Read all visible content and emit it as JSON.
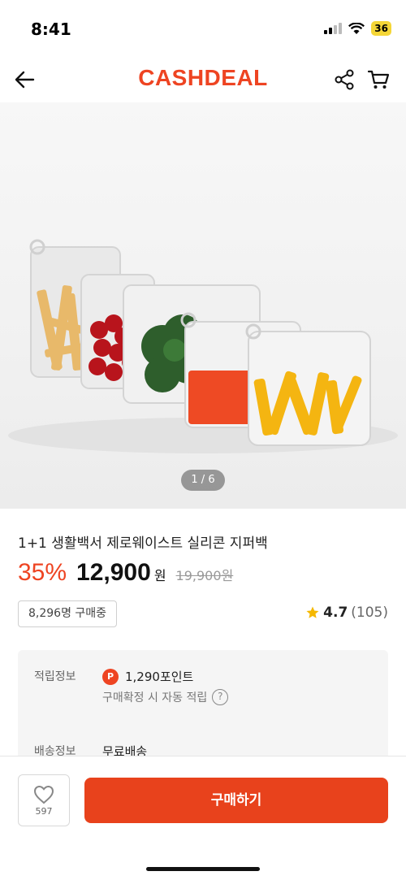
{
  "status_bar": {
    "time": "8:41",
    "battery": "36"
  },
  "header": {
    "logo": "CASHDEAL"
  },
  "gallery": {
    "counter": "1 / 6"
  },
  "product": {
    "title": "1+1 생활백서 제로웨이스트 실리콘 지퍼백",
    "discount": "35%",
    "price": "12,900",
    "currency": "원",
    "original_price": "19,900원",
    "buyers": "8,296명 구매중",
    "rating": "4.7",
    "review_count": "(105)"
  },
  "info": {
    "points_label": "적립정보",
    "points_badge": "P",
    "points_value": "1,290포인트",
    "points_note": "구매확정 시 자동 적립",
    "shipping_label": "배송정보",
    "shipping_value": "무료배송"
  },
  "bottom_bar": {
    "like_count": "597",
    "buy_label": "구매하기"
  },
  "colors": {
    "brand": "#ee4422",
    "buy_button": "#e8421c",
    "star": "#f5b800"
  }
}
